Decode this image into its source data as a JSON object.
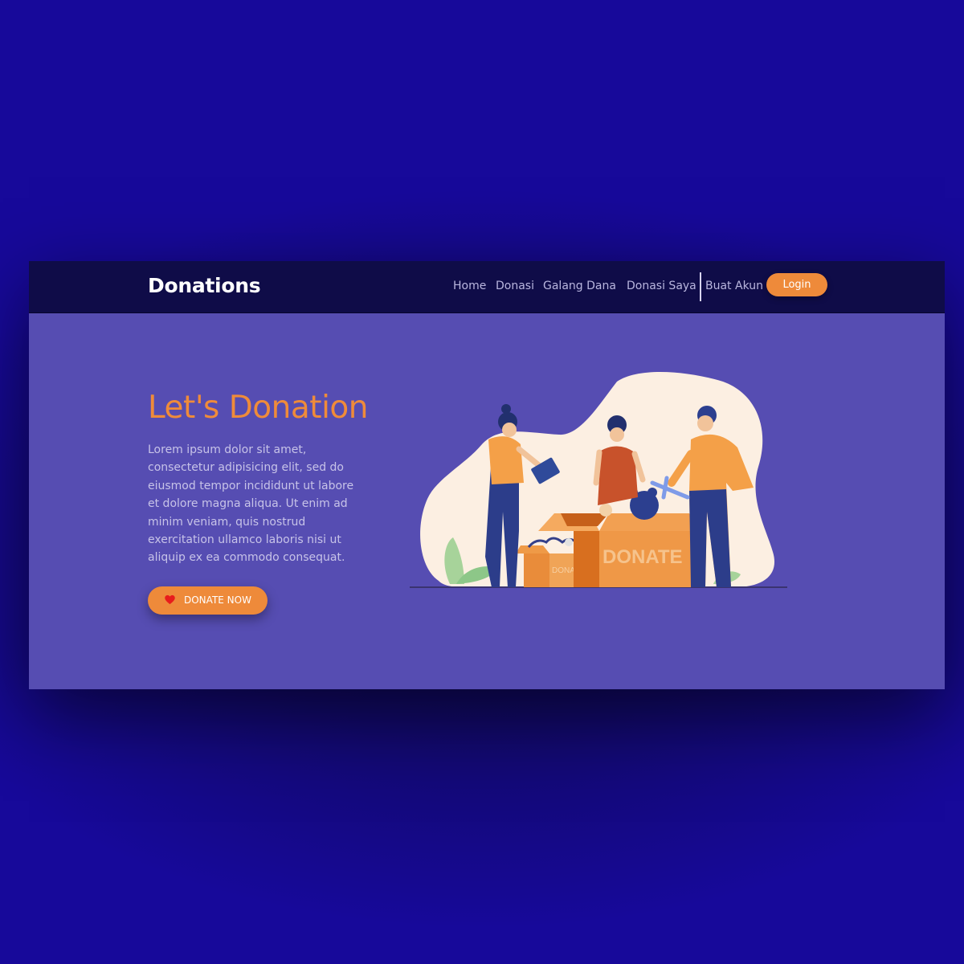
{
  "navbar": {
    "brand": "Donations",
    "links": [
      "Home",
      "Donasi",
      "Galang Dana",
      "Donasi Saya",
      "Buat Akun"
    ],
    "login_label": "Login"
  },
  "hero": {
    "title": "Let's Donation",
    "description": "Lorem ipsum dolor sit amet, consectetur adipisicing elit, sed do eiusmod tempor incididunt ut labore et dolore magna aliqua. Ut enim ad minim veniam, quis nostrud exercitation ullamco laboris nisi ut aliquip ex ea commodo consequat.",
    "button_label": "DONATE NOW",
    "button_icon": "heart-icon",
    "illustration_box_text": "DONATE"
  },
  "colors": {
    "page_background": "#17099a",
    "navbar": "#0f0c48",
    "hero_background": "#564db2",
    "accent": "#ee8a3a",
    "heart": "#e81c1c"
  }
}
